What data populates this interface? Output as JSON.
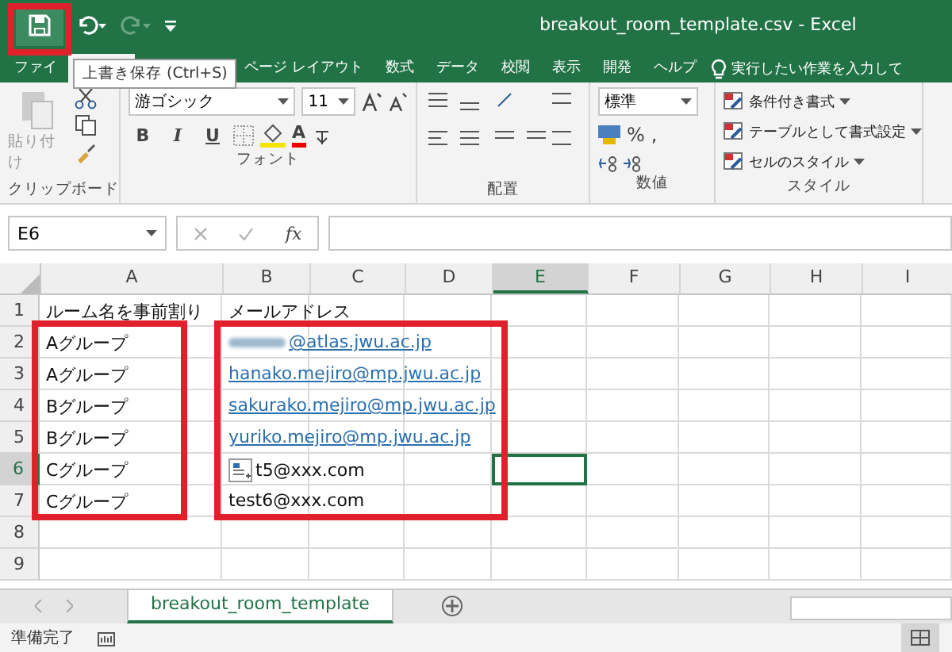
{
  "title_bar": {
    "title": "breakout_room_template.csv  -  Excel"
  },
  "tooltip": {
    "text": "上書き保存 (Ctrl+S)"
  },
  "tabs": [
    {
      "label": "ファイ",
      "selected": false
    },
    {
      "selected": true
    },
    {
      "label": "ページ レイアウト",
      "selected": false
    },
    {
      "label": "数式",
      "selected": false
    },
    {
      "label": "データ",
      "selected": false
    },
    {
      "label": "校閲",
      "selected": false
    },
    {
      "label": "表示",
      "selected": false
    },
    {
      "label": "開発",
      "selected": false
    },
    {
      "label": "ヘルプ",
      "selected": false
    }
  ],
  "tell_me": {
    "placeholder": "実行したい作業を入力して"
  },
  "ribbon": {
    "clipboard": {
      "paste": "貼り付け",
      "label": "クリップボード"
    },
    "font": {
      "name": "游ゴシック",
      "size": "11",
      "bold": "B",
      "italic": "I",
      "underline": "U",
      "color_letter": "A",
      "label": "フォント"
    },
    "alignment": {
      "label": "配置"
    },
    "number": {
      "format": "標準",
      "percent": "%",
      "comma": ",",
      "label": "数値"
    },
    "styles": {
      "items": [
        "条件付き書式",
        "テーブルとして書式設定",
        "セルのスタイル"
      ],
      "label": "スタイル"
    }
  },
  "formula_bar": {
    "name_box": "E6",
    "fx": "fx"
  },
  "sheet": {
    "columns": [
      {
        "label": "A",
        "selected": false
      },
      {
        "label": "B",
        "selected": false
      },
      {
        "label": "C",
        "selected": false
      },
      {
        "label": "D",
        "selected": false
      },
      {
        "label": "E",
        "selected": true
      },
      {
        "label": "F",
        "selected": false
      },
      {
        "label": "G",
        "selected": false
      },
      {
        "label": "H",
        "selected": false
      },
      {
        "label": "I",
        "selected": false
      }
    ],
    "rows": [
      {
        "label": "1",
        "selected": false,
        "cells": [
          {
            "kind": "text",
            "text": "ルーム名を事前割り"
          },
          {
            "kind": "text",
            "text": "メールアドレス"
          }
        ]
      },
      {
        "label": "2",
        "selected": false,
        "cells": [
          {
            "kind": "text",
            "text": "Aグループ"
          },
          {
            "kind": "redacted_link",
            "text": "@atlas.jwu.ac.jp"
          }
        ]
      },
      {
        "label": "3",
        "selected": false,
        "cells": [
          {
            "kind": "text",
            "text": "Aグループ"
          },
          {
            "kind": "link",
            "text": "hanako.mejiro@mp.jwu.ac.jp"
          }
        ]
      },
      {
        "label": "4",
        "selected": false,
        "cells": [
          {
            "kind": "text",
            "text": "Bグループ"
          },
          {
            "kind": "link",
            "text": "sakurako.mejiro@mp.jwu.ac.jp"
          }
        ]
      },
      {
        "label": "5",
        "selected": false,
        "cells": [
          {
            "kind": "text",
            "text": "Bグループ"
          },
          {
            "kind": "link",
            "text": "yuriko.mejiro@mp.jwu.ac.jp"
          }
        ]
      },
      {
        "label": "6",
        "selected": true,
        "cells": [
          {
            "kind": "text",
            "text": "Cグループ"
          },
          {
            "kind": "smart_tag",
            "text": "t5@xxx.com"
          }
        ]
      },
      {
        "label": "7",
        "selected": false,
        "cells": [
          {
            "kind": "text",
            "text": "Cグループ"
          },
          {
            "kind": "text",
            "text": "test6@xxx.com"
          }
        ]
      },
      {
        "label": "8",
        "selected": false,
        "cells": []
      },
      {
        "label": "9",
        "selected": false,
        "cells": []
      }
    ]
  },
  "sheet_tabs": [
    {
      "label": "breakout_room_template",
      "selected": true
    }
  ],
  "status_bar": {
    "text": "準備完了"
  }
}
